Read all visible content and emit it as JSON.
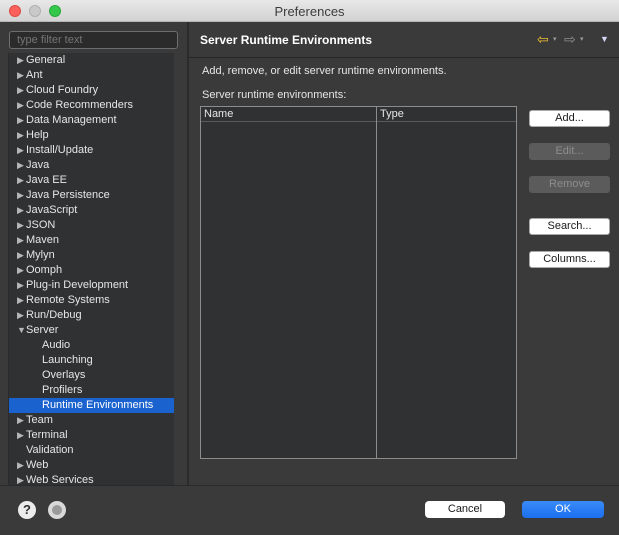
{
  "window": {
    "title": "Preferences"
  },
  "filter": {
    "placeholder": "type filter text"
  },
  "tree": {
    "items": [
      {
        "label": "General",
        "arrow": "▶"
      },
      {
        "label": "Ant",
        "arrow": "▶"
      },
      {
        "label": "Cloud Foundry",
        "arrow": "▶"
      },
      {
        "label": "Code Recommenders",
        "arrow": "▶"
      },
      {
        "label": "Data Management",
        "arrow": "▶"
      },
      {
        "label": "Help",
        "arrow": "▶"
      },
      {
        "label": "Install/Update",
        "arrow": "▶"
      },
      {
        "label": "Java",
        "arrow": "▶"
      },
      {
        "label": "Java EE",
        "arrow": "▶"
      },
      {
        "label": "Java Persistence",
        "arrow": "▶"
      },
      {
        "label": "JavaScript",
        "arrow": "▶"
      },
      {
        "label": "JSON",
        "arrow": "▶"
      },
      {
        "label": "Maven",
        "arrow": "▶"
      },
      {
        "label": "Mylyn",
        "arrow": "▶"
      },
      {
        "label": "Oomph",
        "arrow": "▶"
      },
      {
        "label": "Plug-in Development",
        "arrow": "▶"
      },
      {
        "label": "Remote Systems",
        "arrow": "▶"
      },
      {
        "label": "Run/Debug",
        "arrow": "▶"
      },
      {
        "label": "Server",
        "arrow": "▼"
      },
      {
        "label": "Audio",
        "arrow": ""
      },
      {
        "label": "Launching",
        "arrow": ""
      },
      {
        "label": "Overlays",
        "arrow": ""
      },
      {
        "label": "Profilers",
        "arrow": ""
      },
      {
        "label": "Runtime Environments",
        "arrow": ""
      },
      {
        "label": "Team",
        "arrow": "▶"
      },
      {
        "label": "Terminal",
        "arrow": "▶"
      },
      {
        "label": "Validation",
        "arrow": ""
      },
      {
        "label": "Web",
        "arrow": "▶"
      },
      {
        "label": "Web Services",
        "arrow": "▶"
      }
    ]
  },
  "header": {
    "title": "Server Runtime Environments",
    "back_icon": "⇦",
    "forward_icon": "⇨",
    "dropdown_glyph": "▾",
    "menu_glyph": "▼"
  },
  "content": {
    "description": "Add, remove, or edit server runtime environments.",
    "table_label": "Server runtime environments:",
    "columns": [
      "Name",
      "Type"
    ]
  },
  "buttons": {
    "add": "Add...",
    "edit": "Edit...",
    "remove": "Remove",
    "search": "Search...",
    "columns": "Columns..."
  },
  "footer": {
    "help_glyph": "?",
    "cancel": "Cancel",
    "ok": "OK"
  },
  "colors": {
    "selection": "#1a62cd",
    "ok_button": "#1b6ff0"
  }
}
